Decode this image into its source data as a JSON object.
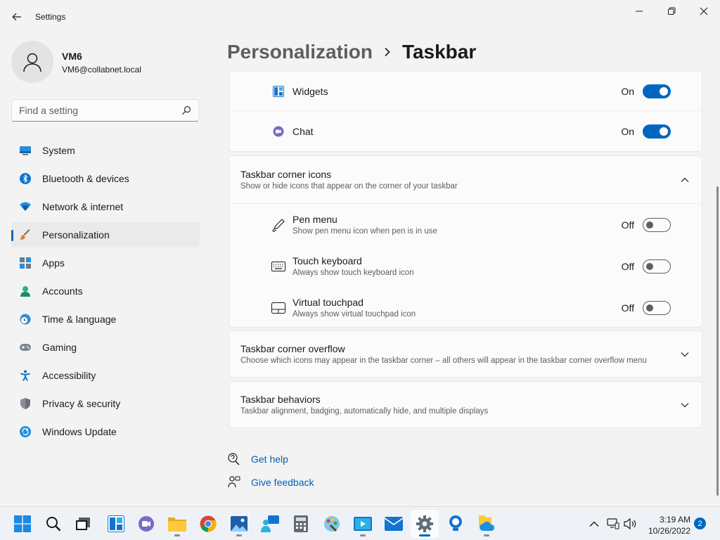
{
  "window": {
    "title": "Settings"
  },
  "user": {
    "name": "VM6",
    "email": "VM6@collabnet.local"
  },
  "search": {
    "placeholder": "Find a setting"
  },
  "nav": {
    "items": [
      {
        "label": "System"
      },
      {
        "label": "Bluetooth & devices"
      },
      {
        "label": "Network & internet"
      },
      {
        "label": "Personalization"
      },
      {
        "label": "Apps"
      },
      {
        "label": "Accounts"
      },
      {
        "label": "Time & language"
      },
      {
        "label": "Gaming"
      },
      {
        "label": "Accessibility"
      },
      {
        "label": "Privacy & security"
      },
      {
        "label": "Windows Update"
      }
    ],
    "active_index": 3
  },
  "breadcrumb": {
    "parent": "Personalization",
    "current": "Taskbar"
  },
  "taskbar_items": [
    {
      "title": "Widgets",
      "state": "On"
    },
    {
      "title": "Chat",
      "state": "On"
    }
  ],
  "corner_icons": {
    "title": "Taskbar corner icons",
    "desc": "Show or hide icons that appear on the corner of your taskbar",
    "items": [
      {
        "title": "Pen menu",
        "desc": "Show pen menu icon when pen is in use",
        "state": "Off"
      },
      {
        "title": "Touch keyboard",
        "desc": "Always show touch keyboard icon",
        "state": "Off"
      },
      {
        "title": "Virtual touchpad",
        "desc": "Always show virtual touchpad icon",
        "state": "Off"
      }
    ]
  },
  "corner_overflow": {
    "title": "Taskbar corner overflow",
    "desc": "Choose which icons may appear in the taskbar corner – all others will appear in the taskbar corner overflow menu"
  },
  "behaviors": {
    "title": "Taskbar behaviors",
    "desc": "Taskbar alignment, badging, automatically hide, and multiple displays"
  },
  "help": {
    "get_help": "Get help",
    "give_feedback": "Give feedback"
  },
  "system_taskbar": {
    "time": "3:19 AM",
    "date": "10/26/2022",
    "notification_count": "2"
  },
  "colors": {
    "accent": "#0067c0",
    "link": "#005fb8",
    "background": "#f3f3f3",
    "card": "#fbfbfb"
  }
}
